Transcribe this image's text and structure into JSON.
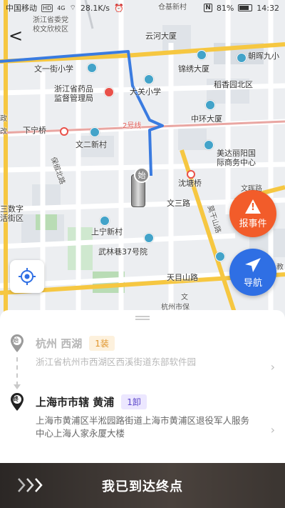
{
  "status_bar": {
    "carrier": "中国移动",
    "hd": "HD",
    "net": "4G",
    "speed": "28.1K/s",
    "battery": "81%",
    "battery_level": 0.81,
    "time": "14:32",
    "nfc": "N"
  },
  "map": {
    "labels": {
      "l1": "浙江省委党",
      "l2": "校文欣校区",
      "l3": "仓基新村",
      "l4": "云河大厦",
      "l5": "文一街小学",
      "l6": "锦绣大厦",
      "l7": "朝晖九小",
      "l8": "浙江省药品",
      "l9": "监督管理局",
      "l10": "大关小学",
      "l11": "稻香园北区",
      "l12": "2号线",
      "l13": "中环大厦",
      "l14": "下宁桥",
      "l15": "文二新村",
      "l16": "美达丽阳国",
      "l17": "际商务中心",
      "l18": "保俶北路",
      "l19": "沈塘桥",
      "l20": "三数字",
      "l21": "活街区",
      "l22": "文三路",
      "l23": "文晖路",
      "l24": "上宁新村",
      "l25": "武林巷37号院",
      "l26": "莫干山路",
      "l27": "天目山路",
      "l28": "文",
      "l29": "杭州市保",
      "l30": "政",
      "l31": "改",
      "l32": "教"
    },
    "back": "<",
    "vehicle_badge": "始",
    "report_label": "报事件",
    "report_icon": "!",
    "nav_label": "导航",
    "colors": {
      "route": "#3a7be0",
      "main_road": "#f6c741",
      "report": "#f25c2a",
      "nav": "#2f6fe4"
    }
  },
  "trip": {
    "from": {
      "badge": "始",
      "name": "杭州 西湖",
      "tag": "1装",
      "address": "浙江省杭州市西湖区西溪街道东部软件园"
    },
    "to": {
      "badge": "终",
      "name": "上海市市辖 黄浦",
      "tag": "1卸",
      "address": "上海市黄浦区半淞园路街道上海市黄浦区退役军人服务中心上海人家永厦大楼"
    },
    "chevron": "›"
  },
  "action": {
    "arrive_label": "我已到达终点"
  }
}
